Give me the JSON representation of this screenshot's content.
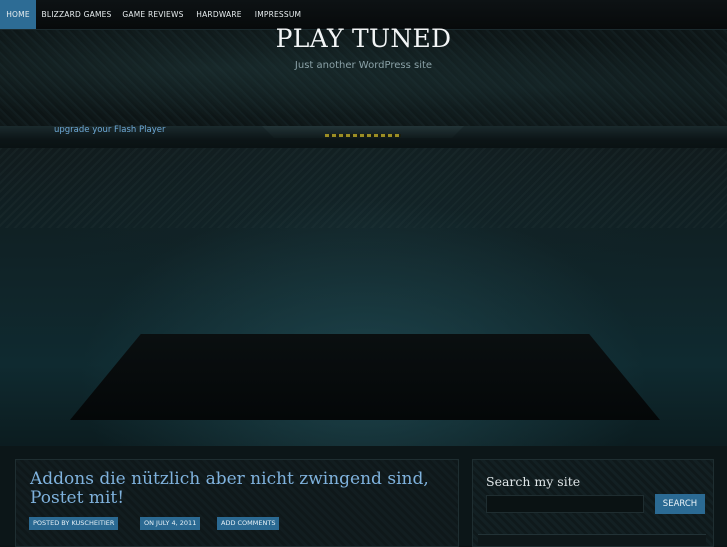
{
  "nav": {
    "items": [
      {
        "label": "HOME",
        "active": true
      },
      {
        "label": "BLIZZARD GAMES",
        "active": false
      },
      {
        "label": "GAME REVIEWS",
        "active": false
      },
      {
        "label": "HARDWARE",
        "active": false
      },
      {
        "label": "IMPRESSUM",
        "active": false
      }
    ]
  },
  "header": {
    "title": "PLAY TUNED",
    "tagline": "Just another WordPress site"
  },
  "flash": {
    "link_text": "upgrade your Flash Player"
  },
  "post": {
    "title": "Addons die nützlich aber nicht zwingend sind, Postet mit!",
    "meta": {
      "author": "POSTED BY KUSCHEITIER",
      "date": "ON JULY 4, 2011",
      "comments": "ADD COMMENTS"
    }
  },
  "sidebar": {
    "search_title": "Search my site",
    "search_value": "",
    "search_button": "SEARCH"
  },
  "colors": {
    "accent": "#2d6c95",
    "link": "#7fb2dd",
    "background": "#0b1416"
  }
}
